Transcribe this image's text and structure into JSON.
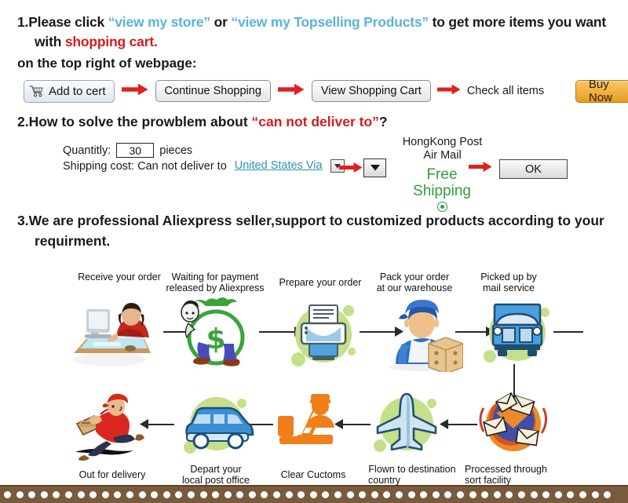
{
  "colors": {
    "link_blue": "#5bb3da",
    "alert_red": "#d61c1c",
    "arrow_red": "#e02020",
    "free_green": "#2f9f3e",
    "buy_orange": "#ea9c22",
    "country_link": "#2d93b5",
    "footer_brown": "#7a5a3c"
  },
  "section1": {
    "number": "1.",
    "lead": "Please click ",
    "link1": "“view my store”",
    "conj": " or ",
    "link2": "“view my Topselling Products”",
    "tail": " to get more items you want",
    "line2_lead": "with ",
    "line2_red": "shopping cart.",
    "subtitle": "on the top right of webpage:",
    "buttons": {
      "add_to_cart": "Add to cert",
      "add_to_cart_icon": "shopping-cart-icon",
      "continue_shopping": "Continue Shopping",
      "view_shopping_cart": "View Shopping Cart",
      "check_all_items": "Check all items",
      "buy_now": "Buy Now"
    }
  },
  "section2": {
    "number": "2.",
    "title_lead": "How to solve the prowblem about ",
    "title_red": "“can not deliver to”",
    "title_tail": "?",
    "quantity_label": "Quantitly:",
    "quantity_value": "30",
    "quantity_unit": "pieces",
    "shipping_label": "Shipping cost: Can not deliver to",
    "country_value": "United States Via",
    "select_caret": "▼",
    "carrier_line1": "HongKong Post",
    "carrier_line2": "Air Mail",
    "free_line1": "Free",
    "free_line2": "Shipping",
    "radio_state": "selected",
    "ok_label": "OK"
  },
  "section3": {
    "number": "3.",
    "line1": "We are professional Aliexpress seller,support to customized products according to your",
    "line2": "requirment."
  },
  "flow": {
    "top_row": [
      {
        "label": "Receive your order",
        "icon": "person-at-computer-icon"
      },
      {
        "label": "Waiting for payment\nreleased by Aliexpress",
        "icon": "money-bag-icon"
      },
      {
        "label": "Prepare your order",
        "icon": "printer-icon"
      },
      {
        "label": "Pack your order\nat our warehouse",
        "icon": "warehouse-worker-icon"
      },
      {
        "label": "Picked up by\nmail service",
        "icon": "truck-icon"
      }
    ],
    "top_labels": [
      "Receive your order",
      "Waiting for payment",
      "released by Aliexpress",
      "Prepare your order",
      "Pack your order",
      "at our warehouse",
      "Picked up by",
      "mail service"
    ],
    "bottom_labels": [
      "Out for delivery",
      "Depart your",
      "local post office",
      "Clear Cuctoms",
      "Flown to destination",
      "country",
      "Processed through",
      "sort facility"
    ],
    "bottom_row": [
      {
        "label": "Out for delivery",
        "icon": "running-courier-icon"
      },
      {
        "label": "Depart your\nlocal post office",
        "icon": "delivery-van-icon"
      },
      {
        "label": "Clear Cuctoms",
        "icon": "customs-officer-icon"
      },
      {
        "label": "Flown to destination\ncountry",
        "icon": "airplane-icon"
      },
      {
        "label": "Processed through\nsort facility",
        "icon": "mail-sorting-icon"
      }
    ]
  }
}
